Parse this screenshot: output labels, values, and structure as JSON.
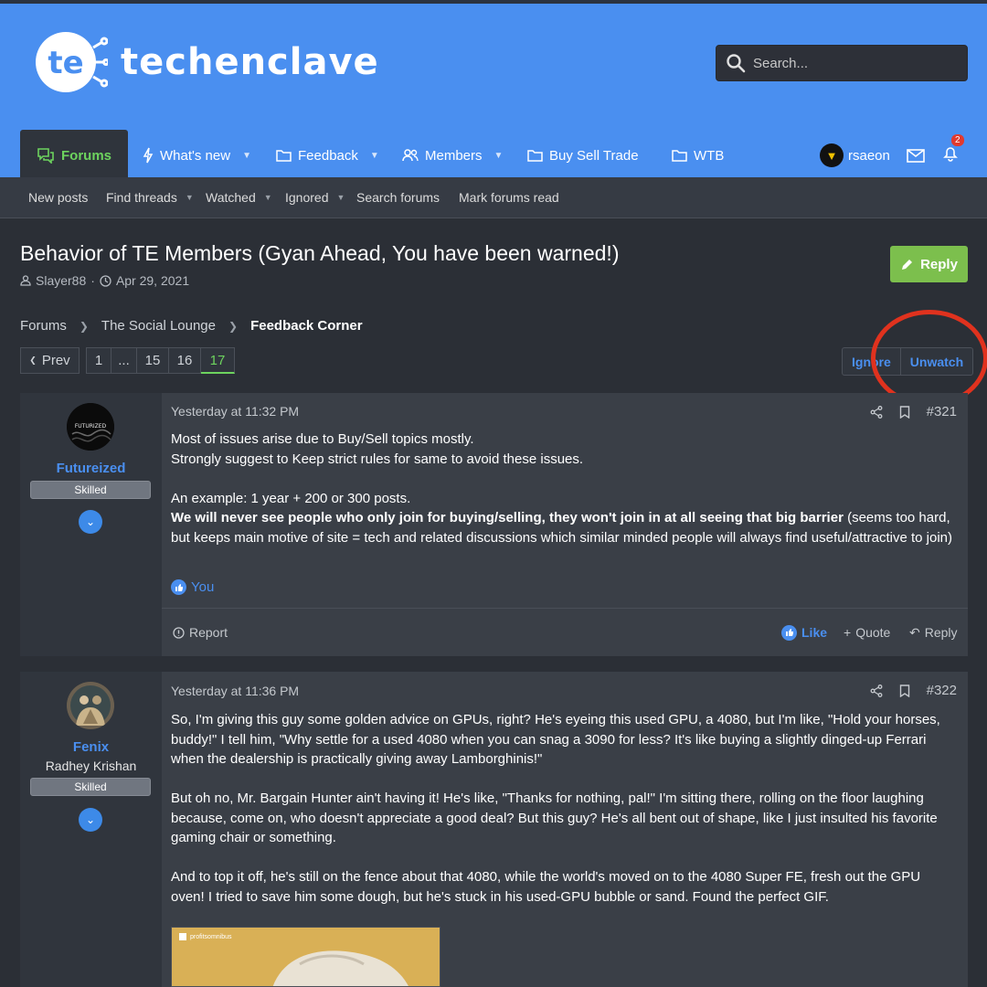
{
  "site": {
    "name": "techenclave",
    "logo_letters": "te"
  },
  "search": {
    "placeholder": "Search..."
  },
  "nav": {
    "items": [
      {
        "label": "Forums",
        "icon": "chat-bubbles-icon"
      },
      {
        "label": "What's new",
        "icon": "flash-icon"
      },
      {
        "label": "Feedback",
        "icon": "folder-icon"
      },
      {
        "label": "Members",
        "icon": "people-icon"
      },
      {
        "label": "Buy Sell Trade",
        "icon": "folder-icon"
      },
      {
        "label": "WTB",
        "icon": "folder-icon"
      }
    ],
    "user": "rsaeon",
    "notifications": "2"
  },
  "subnav": [
    "New posts",
    "Find threads",
    "Watched",
    "Ignored",
    "Search forums",
    "Mark forums read"
  ],
  "thread": {
    "title": "Behavior of TE Members (Gyan Ahead, You have been warned!)",
    "author": "Slayer88",
    "sep": "·",
    "date": "Apr 29, 2021",
    "reply_label": "Reply"
  },
  "breadcrumb": [
    "Forums",
    "The Social Lounge",
    "Feedback Corner"
  ],
  "pager": {
    "prev": "Prev",
    "pages": [
      "1",
      "...",
      "15",
      "16",
      "17"
    ],
    "current": "17"
  },
  "watch": {
    "ignore": "Ignore",
    "unwatch": "Unwatch"
  },
  "posts": [
    {
      "username": "Futureized",
      "avatar_text": "FUTURIZED",
      "rank": "Skilled",
      "time": "Yesterday at 11:32 PM",
      "number": "#321",
      "lines": [
        "Most of issues arise due to Buy/Sell topics mostly.",
        "Strongly suggest to Keep strict rules for same to avoid these issues."
      ],
      "line3": "An example: 1 year + 200 or 300 posts.",
      "bold_text": "We will never see people who only join for buying/selling, they won't join in at all seeing that big barrier",
      "rest_text": " (seems too hard, but keeps main motive of site = tech and related discussions which similar minded people will always find useful/attractive to join)",
      "reaction": "You",
      "actions": {
        "report": "Report",
        "like": "Like",
        "quote": "Quote",
        "reply": "Reply"
      }
    },
    {
      "username": "Fenix",
      "usertitle": "Radhey Krishan",
      "rank": "Skilled",
      "time": "Yesterday at 11:36 PM",
      "number": "#322",
      "p1": "So, I'm giving this guy some golden advice on GPUs, right? He's eyeing this used GPU, a 4080, but I'm like, \"Hold your horses, buddy!\" I tell him, \"Why settle for a used 4080 when you can snag a 3090 for less? It's like buying a slightly dinged-up Ferrari when the dealership is practically giving away Lamborghinis!\"",
      "p2": "But oh no, Mr. Bargain Hunter ain't having it! He's like, \"Thanks for nothing, pal!\" I'm sitting there, rolling on the floor laughing because, come on, who doesn't appreciate a good deal? But this guy? He's all bent out of shape, like I just insulted his favorite gaming chair or something.",
      "p3": "And to top it off, he's still on the fence about that 4080, while the world's moved on to the 4080 Super FE, fresh out the GPU oven! I tried to save him some dough, but he's stuck in his used-GPU bubble or sand. Found the perfect GIF.",
      "gif_caption": "profitsomnibus"
    }
  ]
}
